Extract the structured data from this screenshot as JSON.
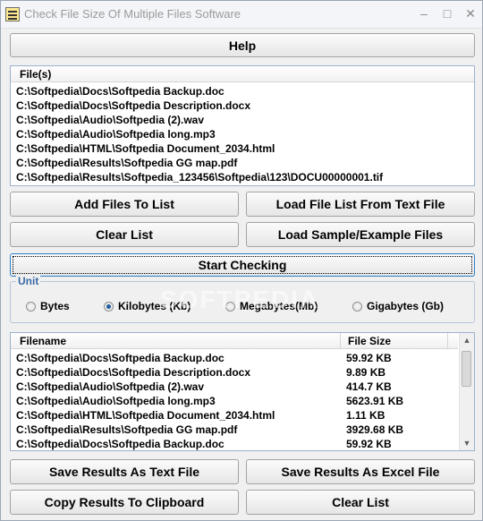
{
  "window": {
    "title": "Check File Size Of Multiple Files Software",
    "minimize": "–",
    "maximize": "□",
    "close": "✕"
  },
  "help_label": "Help",
  "files_list": {
    "header": "File(s)",
    "items": [
      "C:\\Softpedia\\Docs\\Softpedia Backup.doc",
      "C:\\Softpedia\\Docs\\Softpedia Description.docx",
      "C:\\Softpedia\\Audio\\Softpedia (2).wav",
      "C:\\Softpedia\\Audio\\Softpedia long.mp3",
      "C:\\Softpedia\\HTML\\Softpedia Document_2034.html",
      "C:\\Softpedia\\Results\\Softpedia GG map.pdf",
      "C:\\Softpedia\\Results\\Softpedia_123456\\Softpedia\\123\\DOCU00000001.tif"
    ]
  },
  "buttons": {
    "add_files": "Add Files To List",
    "load_list": "Load File List From Text File",
    "clear_list": "Clear List",
    "load_sample": "Load Sample/Example Files",
    "start": "Start Checking",
    "save_text": "Save Results As Text File",
    "save_excel": "Save Results As Excel File",
    "copy_clipboard": "Copy Results To Clipboard",
    "clear_results": "Clear List"
  },
  "unit": {
    "label": "Unit",
    "options": [
      "Bytes",
      "Kilobytes (Kb)",
      "Megabytes(Mb)",
      "Gigabytes (Gb)"
    ],
    "selected": "Kilobytes (Kb)"
  },
  "results": {
    "col_filename": "Filename",
    "col_size": "File Size",
    "rows": [
      {
        "file": "C:\\Softpedia\\Docs\\Softpedia Backup.doc",
        "size": "59.92 KB"
      },
      {
        "file": "C:\\Softpedia\\Docs\\Softpedia Description.docx",
        "size": "9.89 KB"
      },
      {
        "file": "C:\\Softpedia\\Audio\\Softpedia (2).wav",
        "size": "414.7 KB"
      },
      {
        "file": "C:\\Softpedia\\Audio\\Softpedia long.mp3",
        "size": "5623.91 KB"
      },
      {
        "file": "C:\\Softpedia\\HTML\\Softpedia Document_2034.html",
        "size": "1.11 KB"
      },
      {
        "file": "C:\\Softpedia\\Results\\Softpedia GG map.pdf",
        "size": "3929.68 KB"
      },
      {
        "file": "C:\\Softpedia\\Docs\\Softpedia Backup.doc",
        "size": "59.92 KB"
      }
    ]
  },
  "watermark": "SOFTPEDIA"
}
